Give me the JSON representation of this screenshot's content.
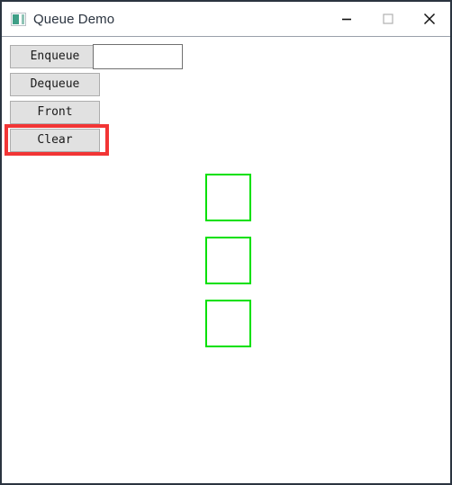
{
  "window": {
    "title": "Queue Demo",
    "icon": "app-window-icon",
    "border_color": "#2b3440",
    "controls": [
      {
        "name": "minimize",
        "glyph": "minimize-icon",
        "label": "Minimize"
      },
      {
        "name": "maximize",
        "glyph": "maximize-icon",
        "label": "Maximize"
      },
      {
        "name": "close",
        "glyph": "close-icon",
        "label": "Close"
      }
    ]
  },
  "toolbar": {
    "enqueue_label": "Enqueue",
    "dequeue_label": "Dequeue",
    "front_label": "Front",
    "clear_label": "Clear"
  },
  "input": {
    "value": "",
    "placeholder": ""
  },
  "highlight": {
    "target": "clear-button",
    "color": "#f23535"
  },
  "queue": {
    "cell_border_color": "#00e000",
    "count": 3,
    "cells": [
      {
        "text": ""
      },
      {
        "text": ""
      },
      {
        "text": ""
      }
    ]
  }
}
